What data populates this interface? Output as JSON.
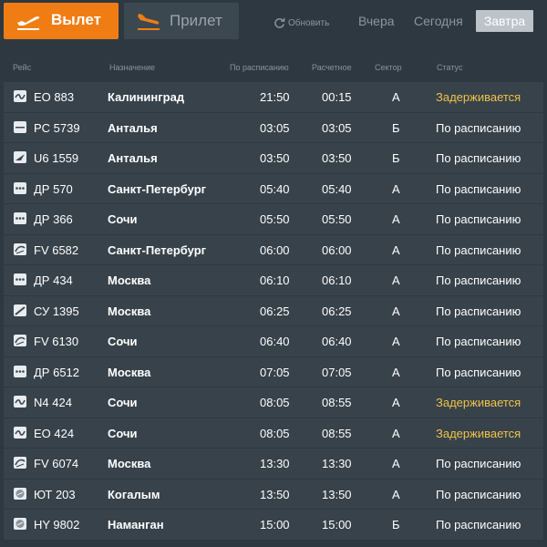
{
  "tabs": {
    "departure": "Вылет",
    "arrival": "Прилет"
  },
  "toolbar": {
    "refresh": "Обновить",
    "yesterday": "Вчера",
    "today": "Сегодня",
    "tomorrow": "Завтра"
  },
  "columns": {
    "flight": "Рейс",
    "destination": "Назначение",
    "scheduled": "По расписанию",
    "estimated": "Расчетное",
    "sector": "Сектор",
    "status": "Статус"
  },
  "colors": {
    "accent": "#f07d14",
    "background": "#2e3840",
    "row": "#37424a",
    "delayed": "#f0c24b",
    "selected_day": "#bcc3c9"
  },
  "flights": [
    {
      "logo": "wave-logo",
      "flight": "EO 883",
      "destination": "Калининград",
      "scheduled": "21:50",
      "estimated": "00:15",
      "sector": "A",
      "status": "Задерживается"
    },
    {
      "logo": "line-logo",
      "flight": "PC 5739",
      "destination": "Анталья",
      "scheduled": "03:05",
      "estimated": "03:05",
      "sector": "Б",
      "status": "По расписанию"
    },
    {
      "logo": "wing-logo",
      "flight": "U6 1559",
      "destination": "Анталья",
      "scheduled": "03:50",
      "estimated": "03:50",
      "sector": "Б",
      "status": "По расписанию"
    },
    {
      "logo": "dots-logo",
      "flight": "ДР 570",
      "destination": "Санкт-Петербург",
      "scheduled": "05:40",
      "estimated": "05:40",
      "sector": "A",
      "status": "По расписанию"
    },
    {
      "logo": "dots-logo",
      "flight": "ДР 366",
      "destination": "Сочи",
      "scheduled": "05:50",
      "estimated": "05:50",
      "sector": "A",
      "status": "По расписанию"
    },
    {
      "logo": "arc-logo",
      "flight": "FV 6582",
      "destination": "Санкт-Петербург",
      "scheduled": "06:00",
      "estimated": "06:00",
      "sector": "A",
      "status": "По расписанию"
    },
    {
      "logo": "dots-logo",
      "flight": "ДР 434",
      "destination": "Москва",
      "scheduled": "06:10",
      "estimated": "06:10",
      "sector": "A",
      "status": "По расписанию"
    },
    {
      "logo": "slash-logo",
      "flight": "СУ 1395",
      "destination": "Москва",
      "scheduled": "06:25",
      "estimated": "06:25",
      "sector": "A",
      "status": "По расписанию"
    },
    {
      "logo": "arc-logo",
      "flight": "FV 6130",
      "destination": "Сочи",
      "scheduled": "06:40",
      "estimated": "06:40",
      "sector": "A",
      "status": "По расписанию"
    },
    {
      "logo": "dots-logo",
      "flight": "ДР 6512",
      "destination": "Москва",
      "scheduled": "07:05",
      "estimated": "07:05",
      "sector": "A",
      "status": "По расписанию"
    },
    {
      "logo": "wave-logo",
      "flight": "N4 424",
      "destination": "Сочи",
      "scheduled": "08:05",
      "estimated": "08:55",
      "sector": "A",
      "status": "Задерживается"
    },
    {
      "logo": "wave-logo",
      "flight": "EO 424",
      "destination": "Сочи",
      "scheduled": "08:05",
      "estimated": "08:55",
      "sector": "A",
      "status": "Задерживается"
    },
    {
      "logo": "arc-logo",
      "flight": "FV 6074",
      "destination": "Москва",
      "scheduled": "13:30",
      "estimated": "13:30",
      "sector": "A",
      "status": "По расписанию"
    },
    {
      "logo": "circle-logo",
      "flight": "ЮТ 203",
      "destination": "Когалым",
      "scheduled": "13:50",
      "estimated": "13:50",
      "sector": "A",
      "status": "По расписанию"
    },
    {
      "logo": "circle-logo",
      "flight": "HY 9802",
      "destination": "Наманган",
      "scheduled": "15:00",
      "estimated": "15:00",
      "sector": "Б",
      "status": "По расписанию"
    }
  ]
}
